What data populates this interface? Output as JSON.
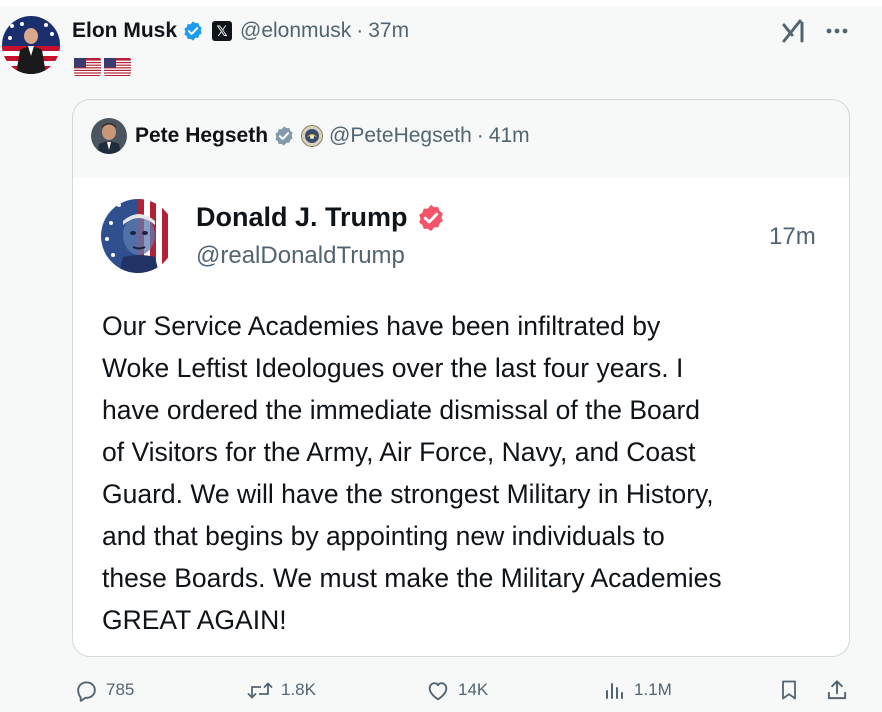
{
  "post": {
    "author_name": "Elon Musk",
    "author_handle": "@elonmusk",
    "separator": "·",
    "time": "37m",
    "text_flags": [
      "us-flag",
      "us-flag"
    ],
    "icons": {
      "verified": "blue-check-icon",
      "affiliate": "x-logo-badge",
      "grok": "grok-icon",
      "more": "more-icon"
    },
    "colors": {
      "verified": "#1d9bf0",
      "gray_verified": "#829aab",
      "trump_badge": "#f4536a",
      "muted_text": "#536471"
    }
  },
  "quote": {
    "author_name": "Pete Hegseth",
    "author_handle": "@PeteHegseth",
    "separator": "·",
    "time": "41m",
    "embedded": {
      "author_name": "Donald J. Trump",
      "author_handle": "@realDonaldTrump",
      "time": "17m",
      "text": "Our Service Academies have been infiltrated by\nWoke Leftist Ideologues over the last four years. I\nhave ordered the immediate dismissal of the Board\nof Visitors for the Army, Air Force, Navy, and Coast\nGuard. We will have the strongest Military in History,\nand that begins by appointing new individuals to\nthese Boards. We must make the Military Academies\nGREAT AGAIN!"
    }
  },
  "actions": {
    "replies": "785",
    "reposts": "1.8K",
    "likes": "14K",
    "views": "1.1M"
  }
}
